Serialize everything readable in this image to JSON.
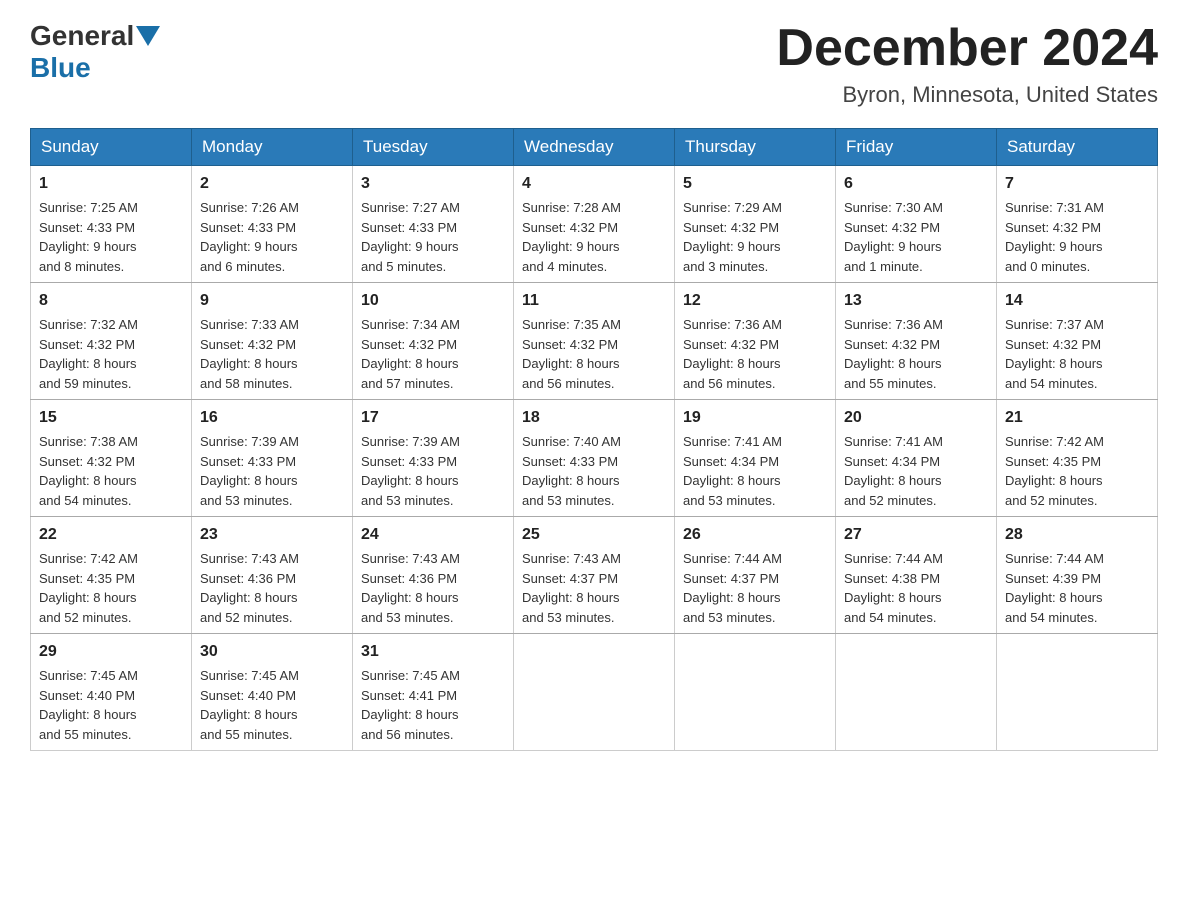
{
  "header": {
    "logo_general": "General",
    "logo_blue": "Blue",
    "month_title": "December 2024",
    "location": "Byron, Minnesota, United States"
  },
  "days_of_week": [
    "Sunday",
    "Monday",
    "Tuesday",
    "Wednesday",
    "Thursday",
    "Friday",
    "Saturday"
  ],
  "weeks": [
    [
      {
        "day": "1",
        "sunrise": "7:25 AM",
        "sunset": "4:33 PM",
        "daylight": "9 hours and 8 minutes."
      },
      {
        "day": "2",
        "sunrise": "7:26 AM",
        "sunset": "4:33 PM",
        "daylight": "9 hours and 6 minutes."
      },
      {
        "day": "3",
        "sunrise": "7:27 AM",
        "sunset": "4:33 PM",
        "daylight": "9 hours and 5 minutes."
      },
      {
        "day": "4",
        "sunrise": "7:28 AM",
        "sunset": "4:32 PM",
        "daylight": "9 hours and 4 minutes."
      },
      {
        "day": "5",
        "sunrise": "7:29 AM",
        "sunset": "4:32 PM",
        "daylight": "9 hours and 3 minutes."
      },
      {
        "day": "6",
        "sunrise": "7:30 AM",
        "sunset": "4:32 PM",
        "daylight": "9 hours and 1 minute."
      },
      {
        "day": "7",
        "sunrise": "7:31 AM",
        "sunset": "4:32 PM",
        "daylight": "9 hours and 0 minutes."
      }
    ],
    [
      {
        "day": "8",
        "sunrise": "7:32 AM",
        "sunset": "4:32 PM",
        "daylight": "8 hours and 59 minutes."
      },
      {
        "day": "9",
        "sunrise": "7:33 AM",
        "sunset": "4:32 PM",
        "daylight": "8 hours and 58 minutes."
      },
      {
        "day": "10",
        "sunrise": "7:34 AM",
        "sunset": "4:32 PM",
        "daylight": "8 hours and 57 minutes."
      },
      {
        "day": "11",
        "sunrise": "7:35 AM",
        "sunset": "4:32 PM",
        "daylight": "8 hours and 56 minutes."
      },
      {
        "day": "12",
        "sunrise": "7:36 AM",
        "sunset": "4:32 PM",
        "daylight": "8 hours and 56 minutes."
      },
      {
        "day": "13",
        "sunrise": "7:36 AM",
        "sunset": "4:32 PM",
        "daylight": "8 hours and 55 minutes."
      },
      {
        "day": "14",
        "sunrise": "7:37 AM",
        "sunset": "4:32 PM",
        "daylight": "8 hours and 54 minutes."
      }
    ],
    [
      {
        "day": "15",
        "sunrise": "7:38 AM",
        "sunset": "4:32 PM",
        "daylight": "8 hours and 54 minutes."
      },
      {
        "day": "16",
        "sunrise": "7:39 AM",
        "sunset": "4:33 PM",
        "daylight": "8 hours and 53 minutes."
      },
      {
        "day": "17",
        "sunrise": "7:39 AM",
        "sunset": "4:33 PM",
        "daylight": "8 hours and 53 minutes."
      },
      {
        "day": "18",
        "sunrise": "7:40 AM",
        "sunset": "4:33 PM",
        "daylight": "8 hours and 53 minutes."
      },
      {
        "day": "19",
        "sunrise": "7:41 AM",
        "sunset": "4:34 PM",
        "daylight": "8 hours and 53 minutes."
      },
      {
        "day": "20",
        "sunrise": "7:41 AM",
        "sunset": "4:34 PM",
        "daylight": "8 hours and 52 minutes."
      },
      {
        "day": "21",
        "sunrise": "7:42 AM",
        "sunset": "4:35 PM",
        "daylight": "8 hours and 52 minutes."
      }
    ],
    [
      {
        "day": "22",
        "sunrise": "7:42 AM",
        "sunset": "4:35 PM",
        "daylight": "8 hours and 52 minutes."
      },
      {
        "day": "23",
        "sunrise": "7:43 AM",
        "sunset": "4:36 PM",
        "daylight": "8 hours and 52 minutes."
      },
      {
        "day": "24",
        "sunrise": "7:43 AM",
        "sunset": "4:36 PM",
        "daylight": "8 hours and 53 minutes."
      },
      {
        "day": "25",
        "sunrise": "7:43 AM",
        "sunset": "4:37 PM",
        "daylight": "8 hours and 53 minutes."
      },
      {
        "day": "26",
        "sunrise": "7:44 AM",
        "sunset": "4:37 PM",
        "daylight": "8 hours and 53 minutes."
      },
      {
        "day": "27",
        "sunrise": "7:44 AM",
        "sunset": "4:38 PM",
        "daylight": "8 hours and 54 minutes."
      },
      {
        "day": "28",
        "sunrise": "7:44 AM",
        "sunset": "4:39 PM",
        "daylight": "8 hours and 54 minutes."
      }
    ],
    [
      {
        "day": "29",
        "sunrise": "7:45 AM",
        "sunset": "4:40 PM",
        "daylight": "8 hours and 55 minutes."
      },
      {
        "day": "30",
        "sunrise": "7:45 AM",
        "sunset": "4:40 PM",
        "daylight": "8 hours and 55 minutes."
      },
      {
        "day": "31",
        "sunrise": "7:45 AM",
        "sunset": "4:41 PM",
        "daylight": "8 hours and 56 minutes."
      },
      null,
      null,
      null,
      null
    ]
  ],
  "labels": {
    "sunrise": "Sunrise:",
    "sunset": "Sunset:",
    "daylight": "Daylight:"
  }
}
